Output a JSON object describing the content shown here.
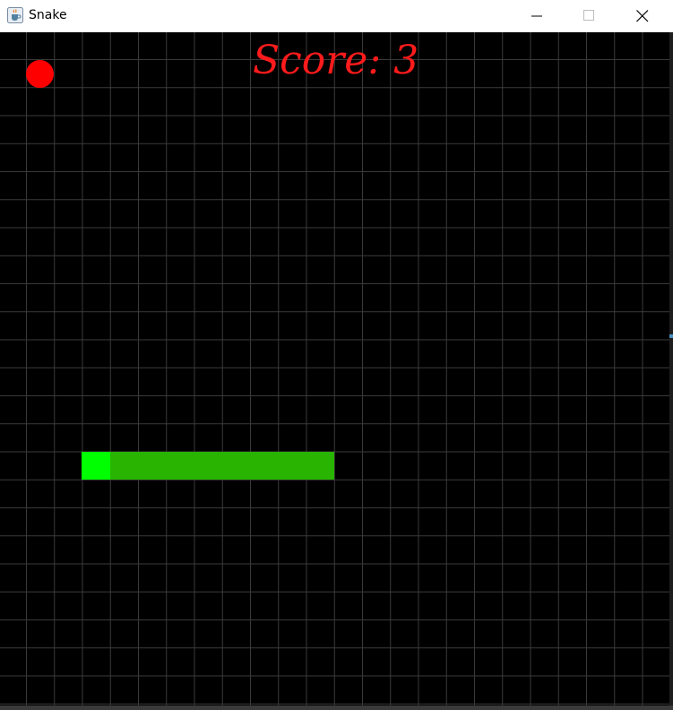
{
  "window": {
    "title": "Snake",
    "icon": "java-cup-icon",
    "controls": [
      "minimize-icon",
      "maximize-icon",
      "close-icon"
    ]
  },
  "game": {
    "score_text": "Score: 3",
    "score": 3,
    "colors": {
      "background": "#000000",
      "grid": "#3b3b3b",
      "score": "#ff1b1b",
      "food": "#ff0000",
      "snake_head": "#00ff00",
      "snake_body": "#28b400"
    }
  }
}
